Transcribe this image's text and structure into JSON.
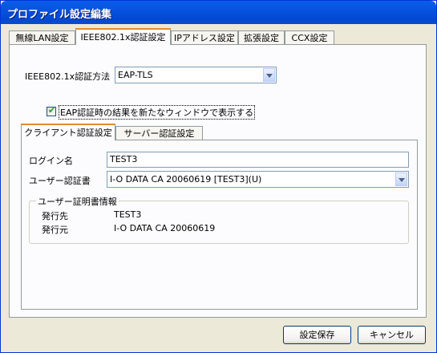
{
  "window": {
    "title": "プロファイル設定編集"
  },
  "tabs": [
    {
      "label": "無線LAN設定"
    },
    {
      "label": "IEEE802.1x認証設定"
    },
    {
      "label": "IPアドレス設定"
    },
    {
      "label": "拡張設定"
    },
    {
      "label": "CCX設定"
    }
  ],
  "auth": {
    "method_label": "IEEE802.1x認証方法",
    "method_value": "EAP-TLS",
    "show_result_checkbox_label": "EAP認証時の結果を新たなウィンドウで表示する",
    "show_result_checked": true
  },
  "subtabs": [
    {
      "label": "クライアント認証設定"
    },
    {
      "label": "サーバー認証設定"
    }
  ],
  "client": {
    "login_label": "ログイン名",
    "login_value": "TEST3",
    "cert_label": "ユーザー認証書",
    "cert_value": "I-O DATA CA 20060619 [TEST3](U)"
  },
  "cert_info": {
    "legend": "ユーザー証明書情報",
    "issued_to_label": "発行先",
    "issued_to_value": "TEST3",
    "issued_by_label": "発行元",
    "issued_by_value": "I-O DATA CA 20060619"
  },
  "buttons": {
    "save": "設定保存",
    "cancel": "キャンセル"
  }
}
